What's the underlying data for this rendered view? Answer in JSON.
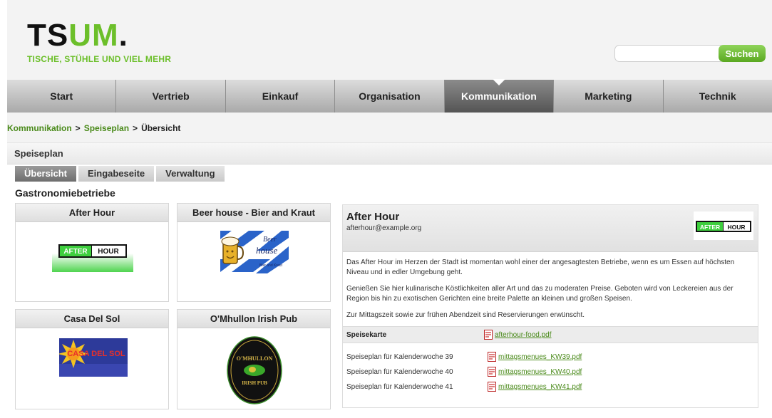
{
  "header": {
    "logo_main": "TSUM.",
    "logo_part1": "TS",
    "logo_part2": "UM",
    "logo_part3": ".",
    "logo_tagline": "TISCHE, STÜHLE UND VIEL MEHR"
  },
  "search": {
    "placeholder": "",
    "value": "",
    "button_label": "Suchen"
  },
  "nav": {
    "items": [
      {
        "label": "Start",
        "active": false
      },
      {
        "label": "Vertrieb",
        "active": false
      },
      {
        "label": "Einkauf",
        "active": false
      },
      {
        "label": "Organisation",
        "active": false
      },
      {
        "label": "Kommunikation",
        "active": true
      },
      {
        "label": "Marketing",
        "active": false
      },
      {
        "label": "Technik",
        "active": false
      }
    ]
  },
  "breadcrumb": {
    "items": [
      "Kommunikation",
      "Speiseplan",
      "Übersicht"
    ],
    "separator": ">"
  },
  "panel": {
    "title": "Speiseplan",
    "tabs": [
      {
        "label": "Übersicht",
        "active": true
      },
      {
        "label": "Eingabeseite",
        "active": false
      },
      {
        "label": "Verwaltung",
        "active": false
      }
    ],
    "section_heading": "Gastronomiebetriebe"
  },
  "restaurants": [
    {
      "name": "After Hour",
      "logo": "afterhour-logo"
    },
    {
      "name": "Beer house - Bier and Kraut",
      "logo": "beerhouse-logo",
      "logo_text_1": "Beer",
      "logo_text_2": "house",
      "logo_text_3": "Bier and Kraut"
    },
    {
      "name": "Casa Del Sol",
      "logo": "casadelsol-logo",
      "logo_text": "CASA DEL SOL"
    },
    {
      "name": "O'Mhullon Irish Pub",
      "logo": "omhullon-logo",
      "logo_text_1": "O'MHULLON",
      "logo_text_2": "IRISH PUB"
    }
  ],
  "logos": {
    "afterhour_part1": "AFTER",
    "afterhour_part2": "HOUR"
  },
  "detail": {
    "name": "After Hour",
    "email": "afterhour@example.org",
    "paragraphs": [
      "Das After Hour im Herzen der Stadt ist momentan wohl einer der angesagtesten Betriebe, wenn es um Essen auf höchsten Niveau und in edler Umgebung geht.",
      "Genießen Sie hier kulinarische Köstlichkeiten aller Art und das zu moderaten Preise. Geboten wird von Leckereien aus der Region bis hin zu exotischen Gerichten eine breite Palette an kleinen und großen Speisen.",
      "Zur Mittagszeit sowie zur frühen Abendzeit sind Reservierungen erwünscht."
    ],
    "menu_label": "Speisekarte",
    "menu_file": "afterhour-food.pdf",
    "weeks": [
      {
        "label": "Speiseplan für Kalenderwoche 39",
        "file": "mittagsmenues_KW39.pdf"
      },
      {
        "label": "Speiseplan für Kalenderwoche 40",
        "file": "mittagsmenues_KW40.pdf"
      },
      {
        "label": "Speiseplan für Kalenderwoche 41",
        "file": "mittagsmenues_KW41.pdf"
      }
    ]
  },
  "colors": {
    "brand_green": "#6cbf2a",
    "link_green": "#4a8a1a",
    "nav_active": "#6e6e6e"
  }
}
